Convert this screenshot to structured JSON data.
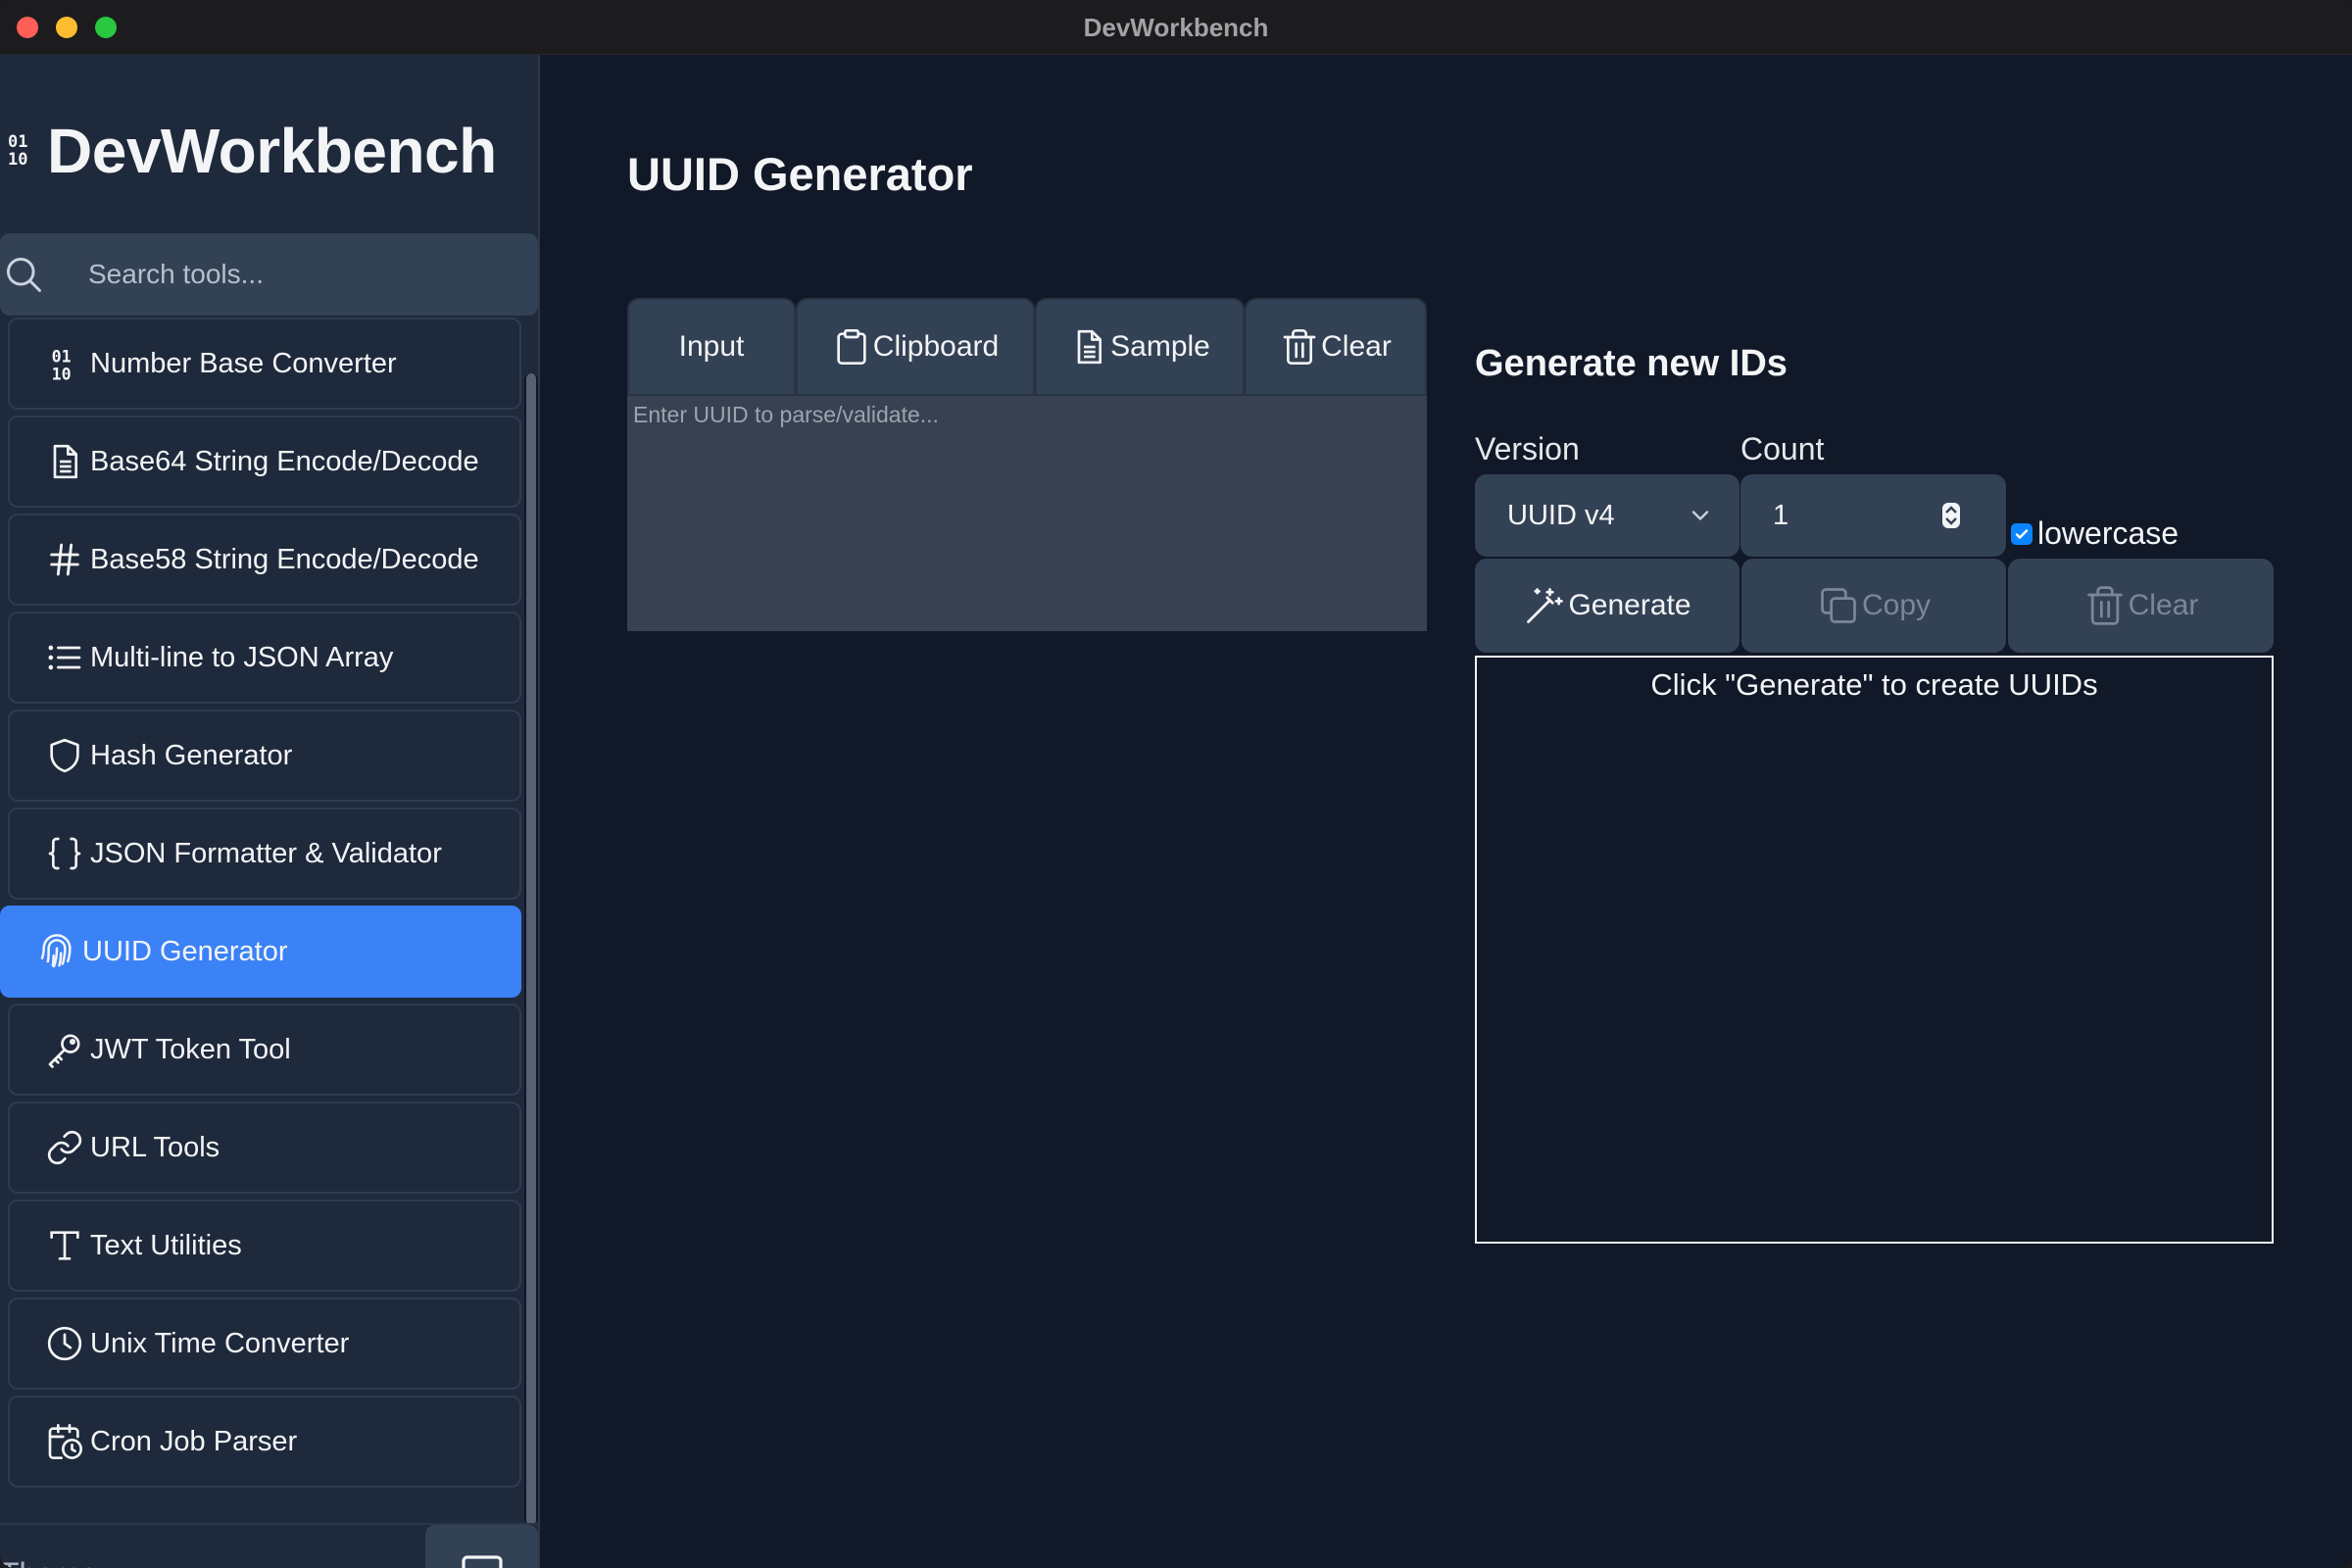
{
  "window": {
    "title": "DevWorkbench"
  },
  "sidebar": {
    "brand": "DevWorkbench",
    "brand_icon_top": "01",
    "brand_icon_bottom": "10",
    "search_placeholder": "Search tools...",
    "items": [
      {
        "label": "Number Base Converter",
        "icon": "binary-icon"
      },
      {
        "label": "Base64 String Encode/Decode",
        "icon": "file-text-icon"
      },
      {
        "label": "Base58 String Encode/Decode",
        "icon": "hash-icon"
      },
      {
        "label": "Multi-line to JSON Array",
        "icon": "list-icon"
      },
      {
        "label": "Hash Generator",
        "icon": "shield-icon"
      },
      {
        "label": "JSON Formatter & Validator",
        "icon": "braces-icon"
      },
      {
        "label": "UUID Generator",
        "icon": "fingerprint-icon",
        "active": true
      },
      {
        "label": "JWT Token Tool",
        "icon": "key-icon"
      },
      {
        "label": "URL Tools",
        "icon": "link-icon"
      },
      {
        "label": "Text Utilities",
        "icon": "type-icon"
      },
      {
        "label": "Unix Time Converter",
        "icon": "clock-icon"
      },
      {
        "label": "Cron Job Parser",
        "icon": "calendar-clock-icon"
      }
    ],
    "theme_label": "Theme",
    "theme_icon": "monitor-icon"
  },
  "main": {
    "title": "UUID Generator",
    "input_tabs": [
      {
        "label": "Input"
      },
      {
        "label": "Clipboard",
        "icon": "clipboard-icon"
      },
      {
        "label": "Sample",
        "icon": "file-text-icon"
      },
      {
        "label": "Clear",
        "icon": "trash-icon"
      }
    ],
    "input_placeholder": "Enter UUID to parse/validate...",
    "generate": {
      "title": "Generate new IDs",
      "version_label": "Version",
      "version_value": "UUID v4",
      "count_label": "Count",
      "count_value": "1",
      "lowercase_label": "lowercase",
      "lowercase_checked": true,
      "buttons": {
        "generate": "Generate",
        "copy": "Copy",
        "clear": "Clear"
      },
      "output_hint": "Click \"Generate\" to create UUIDs"
    }
  },
  "colors": {
    "accent": "#3b82f6",
    "background": "#111827",
    "sidebar": "#1e293b",
    "control": "#334155"
  }
}
